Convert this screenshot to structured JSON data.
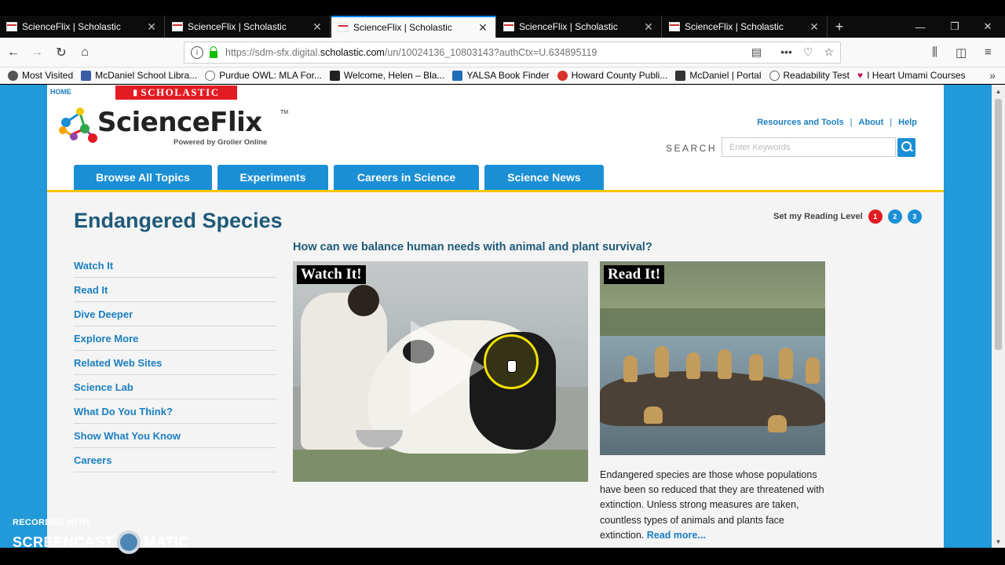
{
  "browser": {
    "tabs": [
      {
        "title": "ScienceFlix | Scholastic"
      },
      {
        "title": "ScienceFlix | Scholastic"
      },
      {
        "title": "ScienceFlix | Scholastic"
      },
      {
        "title": "ScienceFlix | Scholastic"
      },
      {
        "title": "ScienceFlix | Scholastic"
      }
    ],
    "active_tab_index": 2,
    "url_prefix": "https://sdm-sfx.digital.",
    "url_domain": "scholastic.com",
    "url_suffix": "/un/10024136_10803143?authCtx=U.634895119",
    "bookmarks": [
      {
        "label": "Most Visited",
        "icon_color": "#555555"
      },
      {
        "label": "McDaniel School Libra...",
        "icon_color": "#3b5ba5"
      },
      {
        "label": "Purdue OWL: MLA For...",
        "icon_color": "#777777"
      },
      {
        "label": "Welcome, Helen – Bla...",
        "icon_color": "#222222"
      },
      {
        "label": "YALSA Book Finder",
        "icon_color": "#1d6fb8"
      },
      {
        "label": "Howard County Publi...",
        "icon_color": "#d9332b"
      },
      {
        "label": "McDaniel | Portal",
        "icon_color": "#333333"
      },
      {
        "label": "Readability Test",
        "icon_color": "#666666"
      },
      {
        "label": "I Heart Umami Courses",
        "icon_color": "#c2185b"
      }
    ]
  },
  "site": {
    "home_link": "HOME",
    "brand_banner": "SCHOLASTIC",
    "logo_text": "ScienceFlix",
    "logo_tm": "TM",
    "logo_powered": "Powered by Grolier Online",
    "top_links": [
      "Resources and Tools",
      "About",
      "Help"
    ],
    "search_label": "SEARCH",
    "search_placeholder": "Enter Keywords",
    "nav_tabs": [
      "Browse All Topics",
      "Experiments",
      "Careers in Science",
      "Science News"
    ],
    "accent_color": "#1a8fd6",
    "highlight_color": "#f5c800"
  },
  "topic": {
    "title": "Endangered Species",
    "reading_level_label": "Set my Reading Level",
    "reading_levels": [
      {
        "label": "1",
        "color": "#e31b23"
      },
      {
        "label": "2",
        "color": "#1a8fd6"
      },
      {
        "label": "3",
        "color": "#1a8fd6"
      }
    ],
    "question": "How can we balance human needs with animal and plant survival?",
    "side_nav": [
      "Watch It",
      "Read It",
      "Dive Deeper",
      "Explore More",
      "Related Web Sites",
      "Science Lab",
      "What Do You Think?",
      "Show What You Know",
      "Careers"
    ],
    "watch_label": "Watch It!",
    "read_label": "Read It!",
    "read_text": "Endangered species are those whose populations have been so reduced that they are threatened with extinction. Unless strong measures are taken, countless types of animals and plants face extinction.",
    "read_more": "Read more..."
  },
  "watermark": {
    "line1": "RECORDED WITH",
    "line2a": "SCREENCAST",
    "line2b": "MATIC"
  }
}
